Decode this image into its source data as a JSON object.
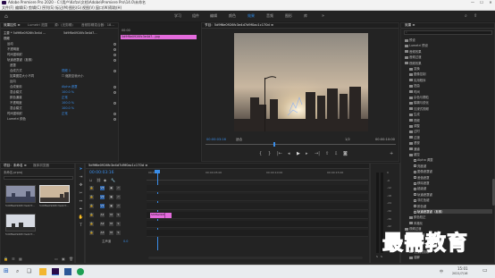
{
  "window": {
    "title": "Adobe Premiere Pro 2020 - C:\\用户\\Ksfzx\\文档\\Adobe\\Premiere Pro\\14.0\\未命名",
    "minimize": "—",
    "maximize": "☐",
    "close": "✕"
  },
  "menu": [
    "文件(F)",
    "编辑(E)",
    "剪辑(C)",
    "序列(S)",
    "标记(M)",
    "图形(G)",
    "视图(V)",
    "窗口(W)",
    "帮助(H)"
  ],
  "workspaces": [
    "学习",
    "组件",
    "编辑",
    "颜色",
    "效果",
    "音频",
    "图形",
    "库"
  ],
  "active_workspace": "效果",
  "effect_controls": {
    "tabs": [
      "效果控件 ≡",
      "Lumetri 范围",
      "源：(无剪辑)",
      "音频剪辑混合器：18..."
    ],
    "master": "主要 * 5d9f6e0926fc3e4d ...",
    "clip_label": "5d9f6e0926fc3e4d7...",
    "section_video": "视频",
    "rows": [
      {
        "label": "运动"
      },
      {
        "label": "不透明度"
      },
      {
        "label": "时间重映射"
      },
      {
        "label": "轨道遮罩键（抠像）"
      },
      {
        "label": "遮罩"
      },
      {
        "label": "合成方式",
        "value": "视频 1"
      },
      {
        "label": "如果图层大小不同"
      },
      {
        "label": "反向"
      },
      {
        "label": "合成使用",
        "value": "Alpha 遮罩"
      },
      {
        "label": "混合模式"
      },
      {
        "label": "颜色通道"
      },
      {
        "label": "不透明度"
      },
      {
        "label": "混合模式"
      },
      {
        "label": "时间重映射"
      },
      {
        "label": "Lumetri 颜色"
      }
    ],
    "checkbox_label": "缩放至帧大小",
    "values": [
      "100.0 %",
      "正常",
      "100.0 %",
      "100.0 %",
      "正常"
    ]
  },
  "source_strip": {
    "timecode": "00:00",
    "clip": "5d9f6e0926fc3e4d7...jpg"
  },
  "program": {
    "tab": "节目：5d9f6e0926fc3e4d7d9f0ac1c170d ≡",
    "timecode_left": "00:00:03:16",
    "fit": "适合",
    "quality": "1/2",
    "timecode_right": "00:00:10:00"
  },
  "effects_panel": {
    "tab": "效果 ≡",
    "search_placeholder": "",
    "items": [
      {
        "label": "预设",
        "indent": 0,
        "type": "folder"
      },
      {
        "label": "Lumetri 预设",
        "indent": 0,
        "type": "folder"
      },
      {
        "label": "音频效果",
        "indent": 0,
        "type": "folder"
      },
      {
        "label": "音频过渡",
        "indent": 0,
        "type": "folder"
      },
      {
        "label": "视频效果",
        "indent": 0,
        "type": "folder"
      },
      {
        "label": "变换",
        "indent": 1,
        "type": "folder"
      },
      {
        "label": "图像控制",
        "indent": 1,
        "type": "folder"
      },
      {
        "label": "实用程序",
        "indent": 1,
        "type": "folder"
      },
      {
        "label": "扭曲",
        "indent": 1,
        "type": "folder"
      },
      {
        "label": "时间",
        "indent": 1,
        "type": "folder"
      },
      {
        "label": "杂色与颗粒",
        "indent": 1,
        "type": "folder"
      },
      {
        "label": "模糊与锐化",
        "indent": 1,
        "type": "folder"
      },
      {
        "label": "沉浸式视频",
        "indent": 1,
        "type": "folder"
      },
      {
        "label": "生成",
        "indent": 1,
        "type": "folder"
      },
      {
        "label": "视频",
        "indent": 1,
        "type": "folder"
      },
      {
        "label": "调整",
        "indent": 1,
        "type": "folder"
      },
      {
        "label": "过时",
        "indent": 1,
        "type": "folder"
      },
      {
        "label": "过渡",
        "indent": 1,
        "type": "folder"
      },
      {
        "label": "透视",
        "indent": 1,
        "type": "folder"
      },
      {
        "label": "通道",
        "indent": 1,
        "type": "folder"
      },
      {
        "label": "键控",
        "indent": 1,
        "type": "folder"
      },
      {
        "label": "Alpha 调整",
        "indent": 2,
        "type": "fx"
      },
      {
        "label": "亮度键",
        "indent": 2,
        "type": "fx"
      },
      {
        "label": "图像遮罩键",
        "indent": 2,
        "type": "fx"
      },
      {
        "label": "差值遮罩",
        "indent": 2,
        "type": "fx"
      },
      {
        "label": "移除遮罩",
        "indent": 2,
        "type": "fx"
      },
      {
        "label": "超级键",
        "indent": 2,
        "type": "fx"
      },
      {
        "label": "轨道遮罩键",
        "indent": 2,
        "type": "fx"
      },
      {
        "label": "非红色键",
        "indent": 2,
        "type": "fx"
      },
      {
        "label": "颜色键",
        "indent": 2,
        "type": "fx"
      },
      {
        "label": "轨道遮罩键（抠像）",
        "indent": 2,
        "type": "fx",
        "selected": true
      },
      {
        "label": "颜色校正",
        "indent": 1,
        "type": "folder"
      },
      {
        "label": "风格化",
        "indent": 1,
        "type": "folder"
      },
      {
        "label": "视频过渡",
        "indent": 0,
        "type": "folder"
      },
      {
        "label": "3D 运动",
        "indent": 1,
        "type": "folder"
      },
      {
        "label": "划像",
        "indent": 1,
        "type": "folder"
      },
      {
        "label": "擦除",
        "indent": 1,
        "type": "folder"
      },
      {
        "label": "沉浸式视频",
        "indent": 1,
        "type": "folder"
      },
      {
        "label": "溶解",
        "indent": 1,
        "type": "folder"
      }
    ]
  },
  "project": {
    "tabs": [
      "项目：未命名 ≡",
      "媒体浏览器"
    ],
    "name": "未命名.prproj",
    "thumbs": [
      {
        "label": "5d9f6e0926fc3e4d7...",
        "duration": "5:00"
      },
      {
        "label": "5d9f6e0926fc3e4d7...",
        "duration": "5:00"
      },
      {
        "label": "5d9f6e0926fc3e4d7...",
        "duration": "5:00"
      }
    ]
  },
  "timeline": {
    "tab": "5d9f6e0926fc3e4d7d9f0ac1c170d ≡",
    "timecode": "00:00:03:16",
    "ruler": [
      "00:00",
      "00:00:05:00",
      "00:00:10:00",
      "00:00:15:00"
    ],
    "tracks": [
      {
        "name": "V3",
        "type": "video"
      },
      {
        "name": "V2",
        "type": "video"
      },
      {
        "name": "V1",
        "type": "video"
      },
      {
        "name": "A1",
        "type": "audio"
      },
      {
        "name": "A2",
        "type": "audio"
      },
      {
        "name": "A3",
        "type": "audio"
      }
    ],
    "clip_label": "5d9f6e0926",
    "master_label": "主声道",
    "master_value": "0.0"
  },
  "meter": {
    "labels": [
      "0",
      "-6",
      "-12",
      "-18",
      "-24",
      "-30",
      "-36",
      "-42",
      "-48",
      "-54",
      "dB"
    ],
    "channels": [
      "S",
      "S"
    ]
  },
  "taskbar": {
    "time": "15:01",
    "date": "2021/7/16",
    "lang": "中"
  },
  "watermark": "最需教育",
  "colors": {
    "accent": "#2d8ceb",
    "clip_pink": "#e36bdc",
    "panel_bg": "#232323",
    "selected_item": "#3e3e3e"
  }
}
